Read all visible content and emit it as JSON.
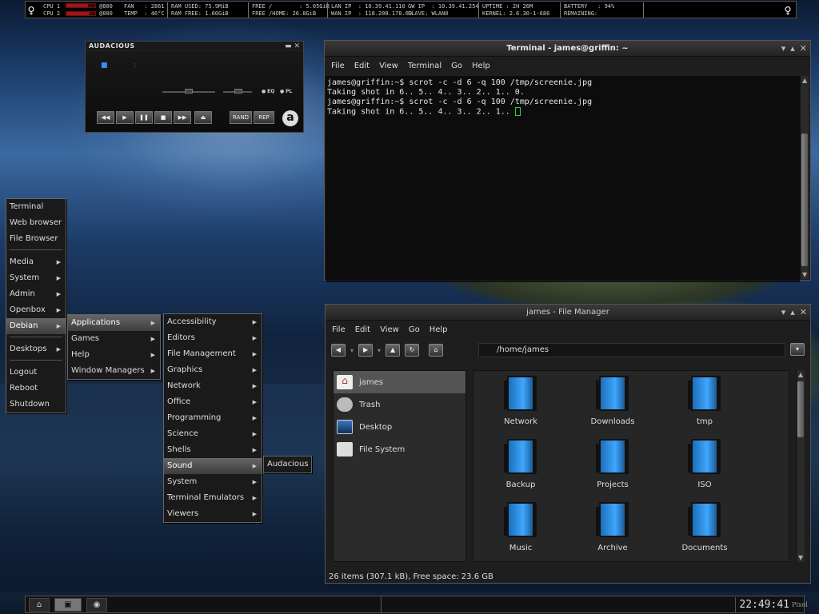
{
  "conky": {
    "cpu1_label": "CPU 1",
    "cpu2_label": "CPU 2",
    "cpu1_freq": "@800",
    "cpu2_freq": "@800",
    "cpu1_load": 0.75,
    "cpu2_load": 0.8,
    "fan": "FAN   : 2861",
    "temp": "TEMP  : 46°C",
    "ram_used": "RAM USED: 75.9MiB",
    "ram_free": "RAM FREE: 1.60GiB",
    "free_root": "FREE /        : 5.05GiB",
    "free_home": "FREE /HOME: 26.8GiB",
    "lan_ip": "LAN IP  : 10.39.41.110",
    "wan_ip": "WAN IP  : 118.208.178.69",
    "gw_ip": "GW IP  : 10.39.41.254",
    "slave": "SLAVE: WLAN0",
    "uptime": "UPTIME : 2H 26M",
    "kernel": "KERNEL: 2.6.30-1-686",
    "battery": "BATTERY   : 94%",
    "remaining": "REMAINING:"
  },
  "audacious": {
    "title": "AUDACIOUS",
    "rand": "RAND",
    "rep": "REP",
    "eq": "EQ",
    "pl": "PL",
    "logo": "a",
    "colon": ":",
    "dot": "■"
  },
  "terminal": {
    "title": "Terminal - james@griffin: ~",
    "menu": [
      "File",
      "Edit",
      "View",
      "Terminal",
      "Go",
      "Help"
    ],
    "lines": [
      "james@griffin:~$ scrot -c -d 6 -q 100 /tmp/screenie.jpg",
      "Taking shot in 6.. 5.. 4.. 3.. 2.. 1.. 0.",
      "james@griffin:~$ scrot -c -d 6 -q 100 /tmp/screenie.jpg",
      "Taking shot in 6.. 5.. 4.. 3.. 2.. 1.. "
    ]
  },
  "file_manager": {
    "title": "james - File Manager",
    "menu": [
      "File",
      "Edit",
      "View",
      "Go",
      "Help"
    ],
    "path": "/home/james",
    "sidebar": [
      {
        "label": "james",
        "icon": "home-icon"
      },
      {
        "label": "Trash",
        "icon": "trash-icon"
      },
      {
        "label": "Desktop",
        "icon": "desktop-icon"
      },
      {
        "label": "File System",
        "icon": "drive-icon"
      }
    ],
    "folders": [
      "Network",
      "Downloads",
      "tmp",
      "Backup",
      "Projects",
      "ISO",
      "Music",
      "Archive",
      "Documents"
    ],
    "status": "26 items (307.1 kB), Free space: 23.6 GB"
  },
  "menus": {
    "root": [
      "Terminal",
      "Web browser",
      "File Browser",
      "Media",
      "System",
      "Admin",
      "Openbox",
      "Debian",
      "Desktops",
      "Logout",
      "Reboot",
      "Shutdown"
    ],
    "debian": [
      "Applications",
      "Games",
      "Help",
      "Window Managers"
    ],
    "applications": [
      "Accessibility",
      "Editors",
      "File Management",
      "Graphics",
      "Network",
      "Office",
      "Programming",
      "Science",
      "Shells",
      "Sound",
      "System",
      "Terminal Emulators",
      "Viewers"
    ],
    "sound": [
      "Audacious"
    ],
    "arrow": "▶"
  },
  "taskbar": {
    "clock": "22:49:41",
    "home_icon": "⌂",
    "term_icon": "▣",
    "circle_icon": "◉"
  },
  "watermark": "Pixel"
}
